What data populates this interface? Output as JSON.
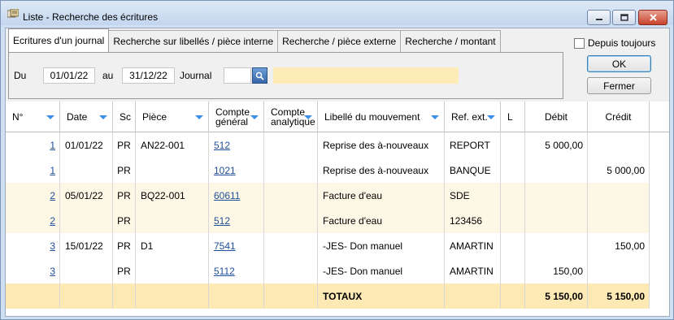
{
  "window": {
    "title": "Liste - Recherche des écritures"
  },
  "tabs": [
    {
      "label": "Ecritures d'un journal",
      "active": true
    },
    {
      "label": "Recherche sur libellés / pièce interne",
      "active": false
    },
    {
      "label": "Recherche / pièce externe",
      "active": false
    },
    {
      "label": "Recherche / montant",
      "active": false
    }
  ],
  "filters": {
    "du_label": "Du",
    "date_from": "01/01/22",
    "au_label": "au",
    "date_to": "31/12/22",
    "journal_label": "Journal",
    "journal_value": "",
    "journal_name": ""
  },
  "options": {
    "depuis_toujours": "Depuis toujours",
    "depuis_toujours_checked": false
  },
  "buttons": {
    "ok": "OK",
    "fermer": "Fermer"
  },
  "columns": [
    {
      "label": "N°",
      "filter": true
    },
    {
      "label": "Date",
      "filter": true
    },
    {
      "label": "Sc",
      "filter": false
    },
    {
      "label": "Pièce",
      "filter": true
    },
    {
      "label": "Compte\ngénéral",
      "filter": true
    },
    {
      "label": "Compte\nanalytique",
      "filter": true
    },
    {
      "label": "Libellé du mouvement",
      "filter": true
    },
    {
      "label": "Ref. ext.",
      "filter": true
    },
    {
      "label": "L",
      "filter": false
    },
    {
      "label": "Débit",
      "filter": false
    },
    {
      "label": "Crédit",
      "filter": false
    }
  ],
  "rows": [
    {
      "num": "1",
      "date": "01/01/22",
      "sc": "PR",
      "piece": "AN22-001",
      "compte": "512",
      "analytique": "",
      "libelle": "Reprise des à-nouveaux",
      "ref": "REPORT",
      "l": "",
      "debit": "5 000,00",
      "credit": "",
      "shaded": false
    },
    {
      "num": "1",
      "date": "",
      "sc": "PR",
      "piece": "",
      "compte": "1021",
      "analytique": "",
      "libelle": "Reprise des à-nouveaux",
      "ref": "BANQUE",
      "l": "",
      "debit": "",
      "credit": "5 000,00",
      "shaded": false
    },
    {
      "num": "2",
      "date": "05/01/22",
      "sc": "PR",
      "piece": "BQ22-001",
      "compte": "60611",
      "analytique": "",
      "libelle": "Facture d'eau",
      "ref": "SDE",
      "l": "",
      "debit": "",
      "credit": "",
      "shaded": true
    },
    {
      "num": "2",
      "date": "",
      "sc": "PR",
      "piece": "",
      "compte": "512",
      "analytique": "",
      "libelle": "Facture d'eau",
      "ref": "123456",
      "l": "",
      "debit": "",
      "credit": "",
      "shaded": true
    },
    {
      "num": "3",
      "date": "15/01/22",
      "sc": "PR",
      "piece": "D1",
      "compte": "7541",
      "analytique": "",
      "libelle": "-JES- Don manuel",
      "ref": "AMARTIN",
      "l": "",
      "debit": "",
      "credit": "150,00",
      "shaded": false
    },
    {
      "num": "3",
      "date": "",
      "sc": "PR",
      "piece": "",
      "compte": "5112",
      "analytique": "",
      "libelle": "-JES- Don manuel",
      "ref": "AMARTIN",
      "l": "",
      "debit": "150,00",
      "credit": "",
      "shaded": false
    }
  ],
  "totals": {
    "label": "TOTAUX",
    "debit": "5 150,00",
    "credit": "5 150,00"
  },
  "colors": {
    "shade": "#fdf8e6",
    "total_bg": "#fde9b4",
    "link": "#1f4f9a",
    "filter_arrow": "#3a8ee6"
  }
}
